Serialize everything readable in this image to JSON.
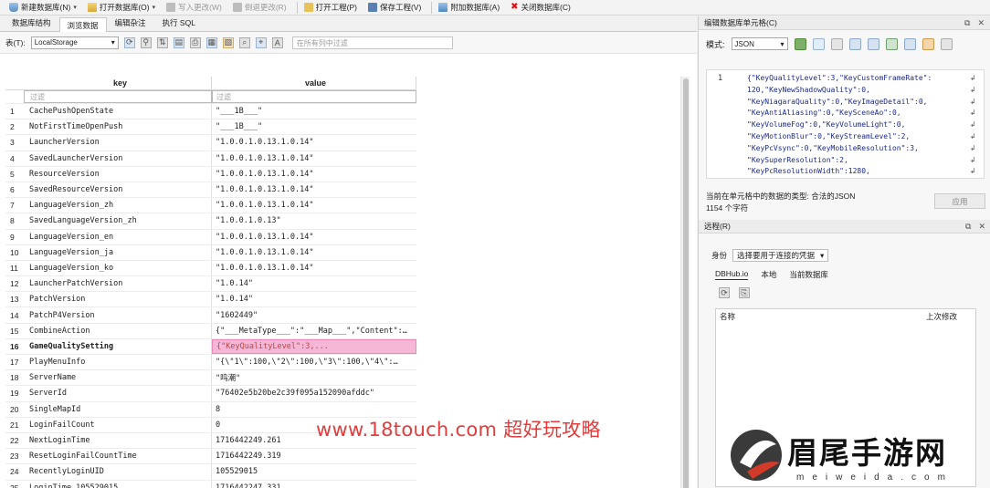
{
  "toolbar": {
    "new_db": "新建数据库(N)",
    "open_db": "打开数据库(O)",
    "write_changes": "写入更改(W)",
    "revert_changes": "倒退更改(R)",
    "open_project": "打开工程(P)",
    "save_project": "保存工程(V)",
    "attach_db": "附加数据库(A)",
    "close_db": "关闭数据库(C)"
  },
  "tabs": [
    {
      "label": "数据库结构"
    },
    {
      "label": "浏览数据"
    },
    {
      "label": "编辑杂注"
    },
    {
      "label": "执行 SQL"
    }
  ],
  "browse": {
    "table_label": "表(T):",
    "table_value": "LocalStorage",
    "filter_all_placeholder": "在所有列中过滤"
  },
  "grid": {
    "col_key": "key",
    "col_value": "value",
    "filter_placeholder": "过滤",
    "rows": [
      {
        "n": "1",
        "key": "CachePushOpenState",
        "value": "\"___1B___\""
      },
      {
        "n": "2",
        "key": "NotFirstTimeOpenPush",
        "value": "\"___1B___\""
      },
      {
        "n": "3",
        "key": "LauncherVersion",
        "value": "\"1.0.0.1.0.13.1.0.14\""
      },
      {
        "n": "4",
        "key": "SavedLauncherVersion",
        "value": "\"1.0.0.1.0.13.1.0.14\""
      },
      {
        "n": "5",
        "key": "ResourceVersion",
        "value": "\"1.0.0.1.0.13.1.0.14\""
      },
      {
        "n": "6",
        "key": "SavedResourceVersion",
        "value": "\"1.0.0.1.0.13.1.0.14\""
      },
      {
        "n": "7",
        "key": "LanguageVersion_zh",
        "value": "\"1.0.0.1.0.13.1.0.14\""
      },
      {
        "n": "8",
        "key": "SavedLanguageVersion_zh",
        "value": "\"1.0.0.1.0.13\""
      },
      {
        "n": "9",
        "key": "LanguageVersion_en",
        "value": "\"1.0.0.1.0.13.1.0.14\""
      },
      {
        "n": "10",
        "key": "LanguageVersion_ja",
        "value": "\"1.0.0.1.0.13.1.0.14\""
      },
      {
        "n": "11",
        "key": "LanguageVersion_ko",
        "value": "\"1.0.0.1.0.13.1.0.14\""
      },
      {
        "n": "12",
        "key": "LauncherPatchVersion",
        "value": "\"1.0.14\""
      },
      {
        "n": "13",
        "key": "PatchVersion",
        "value": "\"1.0.14\""
      },
      {
        "n": "14",
        "key": "PatchP4Version",
        "value": "\"1602449\""
      },
      {
        "n": "15",
        "key": "CombineAction",
        "value": "{\"___MetaType___\":\"___Map___\",\"Content\":…"
      },
      {
        "n": "16",
        "key": "GameQualitySetting",
        "value": "{\"KeyQualityLevel\":3,..."
      },
      {
        "n": "17",
        "key": "PlayMenuInfo",
        "value": "\"{\\\"1\\\":100,\\\"2\\\":100,\\\"3\\\":100,\\\"4\\\":…"
      },
      {
        "n": "18",
        "key": "ServerName",
        "value": "\"鸣潮\""
      },
      {
        "n": "19",
        "key": "ServerId",
        "value": "\"76402e5b20be2c39f095a152090afddc\""
      },
      {
        "n": "20",
        "key": "SingleMapId",
        "value": "8"
      },
      {
        "n": "21",
        "key": "LoginFailCount",
        "value": "0"
      },
      {
        "n": "22",
        "key": "NextLoginTime",
        "value": "1716442249.261"
      },
      {
        "n": "23",
        "key": "ResetLoginFailCountTime",
        "value": "1716442249.319"
      },
      {
        "n": "24",
        "key": "RecentlyLoginUID",
        "value": "105529015"
      },
      {
        "n": "25",
        "key": "LoginTime_105529015",
        "value": "1716442247.331"
      }
    ]
  },
  "watermark": "www.18touch.com 超好玩攻略",
  "edit_cell": {
    "title": "编辑数据库单元格(C)",
    "mode_label": "模式:",
    "mode_value": "JSON",
    "line_no": "1",
    "json_lines": [
      "{\"KeyQualityLevel\":3,\"KeyCustomFrameRate\":",
      "120,\"KeyNewShadowQuality\":0,",
      "\"KeyNiagaraQuality\":0,\"KeyImageDetail\":0,",
      "\"KeyAntiAliasing\":0,\"KeySceneAo\":0,",
      "\"KeyVolumeFog\":0,\"KeyVolumeLight\":0,",
      "\"KeyMotionBlur\":0,\"KeyStreamLevel\":2,",
      "\"KeyPcVsync\":0,\"KeyMobileResolution\":3,",
      "\"KeySuperResolution\":2,",
      "\"KeyPcResolutionWidth\":1280,"
    ],
    "type_text": "当前在单元格中的数据的类型: 合法的JSON",
    "char_count": "1154 个字符",
    "apply": "应用"
  },
  "remote": {
    "title": "远程(R)",
    "identity_label": "身份",
    "identity_value": "选择要用于连接的凭据",
    "tabs": [
      {
        "label": "DBHub.io"
      },
      {
        "label": "本地"
      },
      {
        "label": "当前数据库"
      }
    ],
    "col_name": "名称",
    "col_modified": "上次修改"
  },
  "logo": {
    "text": "眉尾手游网",
    "sub": "meiweida.com"
  }
}
